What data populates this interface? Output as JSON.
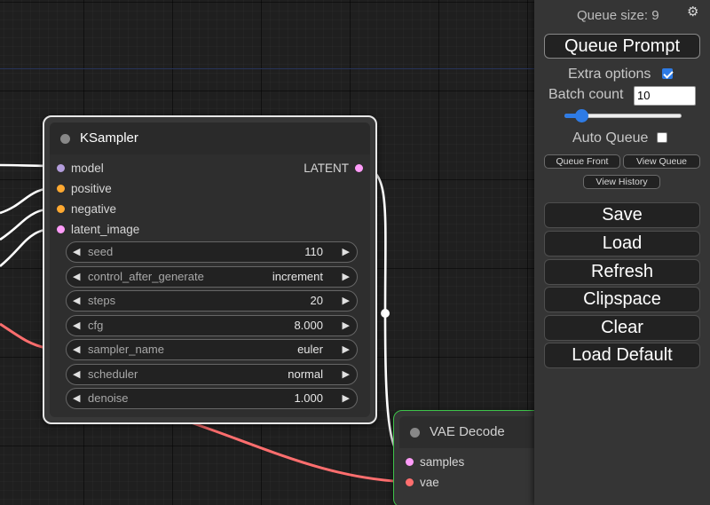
{
  "ksampler": {
    "title": "KSampler",
    "inputs": [
      {
        "label": "model",
        "color": "#b39ddb"
      },
      {
        "label": "positive",
        "color": "#ffa931"
      },
      {
        "label": "negative",
        "color": "#ffa931"
      },
      {
        "label": "latent_image",
        "color": "#ff9cf9"
      }
    ],
    "output": {
      "label": "LATENT",
      "color": "#ff9cf9"
    },
    "widgets": [
      {
        "label": "seed",
        "value": "110"
      },
      {
        "label": "control_after_generate",
        "value": "increment"
      },
      {
        "label": "steps",
        "value": "20"
      },
      {
        "label": "cfg",
        "value": "8.000"
      },
      {
        "label": "sampler_name",
        "value": "euler"
      },
      {
        "label": "scheduler",
        "value": "normal"
      },
      {
        "label": "denoise",
        "value": "1.000"
      }
    ]
  },
  "vae_decode": {
    "title": "VAE Decode",
    "inputs": [
      {
        "label": "samples",
        "color": "#ff9cf9"
      },
      {
        "label": "vae",
        "color": "#ff6e6e"
      }
    ],
    "border_color": "#3ec34a"
  },
  "menu": {
    "queue_size": "Queue size: 9",
    "queue_prompt": "Queue Prompt",
    "extra_options": "Extra options",
    "extra_options_checked": true,
    "batch_count_label": "Batch count",
    "batch_count_value": "10",
    "batch_slider_fraction": 0.1,
    "auto_queue": "Auto Queue",
    "auto_queue_checked": false,
    "queue_front": "Queue Front",
    "view_queue": "View Queue",
    "view_history": "View History",
    "buttons": [
      "Save",
      "Load",
      "Refresh",
      "Clipspace",
      "Clear",
      "Load Default"
    ]
  },
  "colors": {
    "accent": "#2e7be5",
    "link_white": "#ffffff",
    "link_vae": "#ff6e6e",
    "link_clip": "#4ab0e8"
  },
  "icons": {
    "settings": "gear-icon"
  }
}
